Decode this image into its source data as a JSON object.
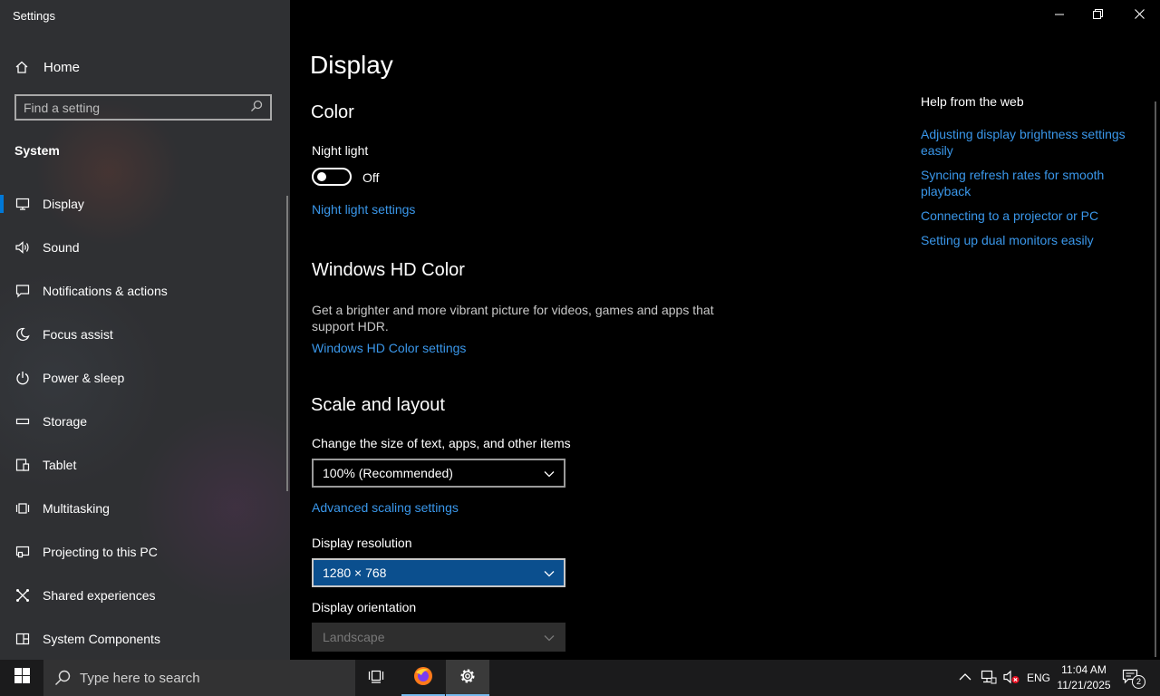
{
  "app": {
    "title": "Settings"
  },
  "sidebar": {
    "home_label": "Home",
    "search_placeholder": "Find a setting",
    "section_label": "System",
    "items": [
      {
        "label": "Display",
        "icon": "monitor-icon",
        "active": true
      },
      {
        "label": "Sound",
        "icon": "speaker-icon"
      },
      {
        "label": "Notifications & actions",
        "icon": "notification-icon"
      },
      {
        "label": "Focus assist",
        "icon": "moon-icon"
      },
      {
        "label": "Power & sleep",
        "icon": "power-icon"
      },
      {
        "label": "Storage",
        "icon": "storage-icon"
      },
      {
        "label": "Tablet",
        "icon": "tablet-icon"
      },
      {
        "label": "Multitasking",
        "icon": "multitasking-icon"
      },
      {
        "label": "Projecting to this PC",
        "icon": "projecting-icon"
      },
      {
        "label": "Shared experiences",
        "icon": "shared-experiences-icon"
      },
      {
        "label": "System Components",
        "icon": "system-components-icon"
      }
    ]
  },
  "main": {
    "title": "Display",
    "color": {
      "heading": "Color",
      "night_light_label": "Night light",
      "night_light_state": "Off",
      "night_light_link": "Night light settings"
    },
    "hdr": {
      "heading": "Windows HD Color",
      "description": "Get a brighter and more vibrant picture for videos, games and apps that support HDR.",
      "link": "Windows HD Color settings"
    },
    "scale": {
      "heading": "Scale and layout",
      "size_label": "Change the size of text, apps, and other items",
      "size_value": "100% (Recommended)",
      "advanced_link": "Advanced scaling settings",
      "resolution_label": "Display resolution",
      "resolution_value": "1280 × 768",
      "orientation_label": "Display orientation",
      "orientation_value": "Landscape"
    }
  },
  "help": {
    "title": "Help from the web",
    "links": [
      "Adjusting display brightness settings easily",
      "Syncing refresh rates for smooth playback",
      "Connecting to a projector or PC",
      "Setting up dual monitors easily"
    ]
  },
  "taskbar": {
    "search_placeholder": "Type here to search",
    "language": "ENG",
    "time": "11:04 AM",
    "date": "11/21/2025",
    "notification_count": "2"
  },
  "colors": {
    "accent": "#0078d7",
    "link": "#3a97ea",
    "selected_dropdown": "#0b4f8e"
  }
}
